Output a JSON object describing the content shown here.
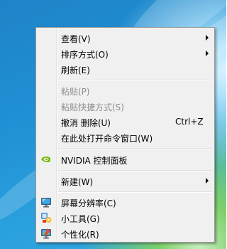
{
  "menu": {
    "items": [
      {
        "label": "查看(V)",
        "submenu": true,
        "enabled": true
      },
      {
        "label": "排序方式(O)",
        "submenu": true,
        "enabled": true
      },
      {
        "label": "刷新(E)",
        "enabled": true
      },
      {
        "label": "粘贴(P)",
        "enabled": false
      },
      {
        "label": "粘贴快捷方式(S)",
        "enabled": false
      },
      {
        "label": "撤消 删除(U)",
        "shortcut": "Ctrl+Z",
        "enabled": true
      },
      {
        "label": "在此处打开命令窗口(W)",
        "enabled": true
      },
      {
        "label": "NVIDIA 控制面板",
        "icon": "nvidia-icon",
        "enabled": true
      },
      {
        "label": "新建(W)",
        "submenu": true,
        "enabled": true
      },
      {
        "label": "屏幕分辨率(C)",
        "icon": "monitor-icon",
        "enabled": true
      },
      {
        "label": "小工具(G)",
        "icon": "gadgets-icon",
        "enabled": true
      },
      {
        "label": "个性化(R)",
        "icon": "personalize-icon",
        "enabled": true
      }
    ]
  },
  "colors": {
    "menu_background": "#f0f0f0",
    "menu_border": "#979797",
    "disabled_text": "#8d8d8d",
    "nvidia_green": "#76b900"
  }
}
